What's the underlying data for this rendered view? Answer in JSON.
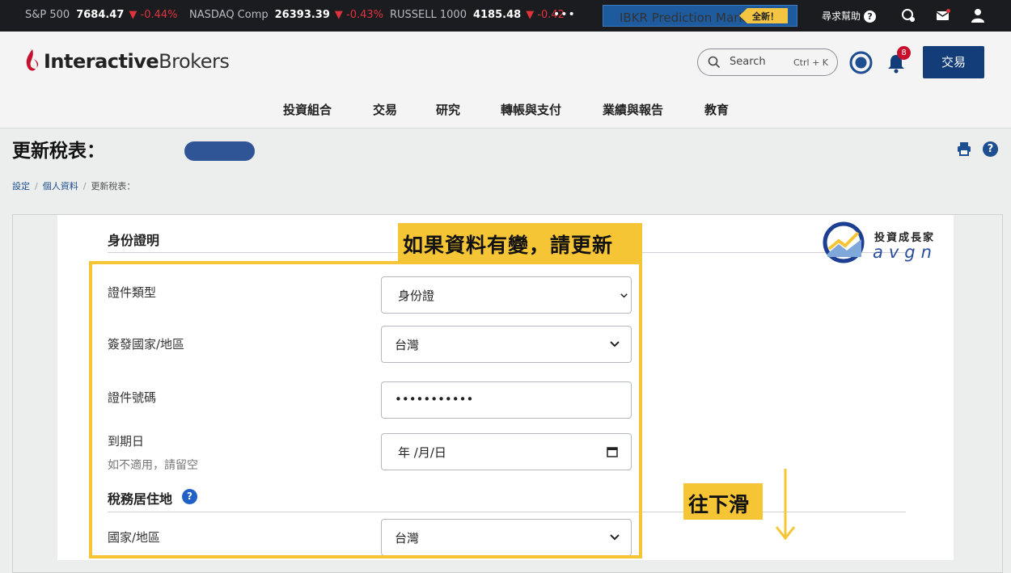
{
  "ticker": {
    "items": [
      {
        "name": "S&P 500",
        "value": "7684.47",
        "change": "▼ -0.44%"
      },
      {
        "name": "NASDAQ Comp",
        "value": "26393.39",
        "change": "▼ -0.43%"
      },
      {
        "name": "RUSSELL 1000",
        "value": "4185.48",
        "change": "▼ -0.42"
      }
    ],
    "more": "•••",
    "promo_label": "IBKR Prediction Markets",
    "promo_badge": "全新！",
    "help_label": "尋求幫助",
    "help_q": "?"
  },
  "header": {
    "logo_bold": "Interactive",
    "logo_rest": "Brokers",
    "search_placeholder": "Search",
    "search_shortcut": "Ctrl + K",
    "notification_count": "8",
    "trade_button": "交易",
    "nav": [
      "投資組合",
      "交易",
      "研究",
      "轉帳與支付",
      "業績與報告",
      "教育"
    ]
  },
  "page": {
    "title": "更新稅表：",
    "help": "?",
    "breadcrumb": [
      "設定",
      "個人資料",
      "更新稅表："
    ]
  },
  "form": {
    "identity_section": "身份證明",
    "id_type_label": "證件類型",
    "id_type_value": "身份證",
    "issue_country_label": "簽發國家/地區",
    "issue_country_value": "台灣",
    "id_number_label": "證件號碼",
    "id_number_value": "•••••••••••",
    "expiry_label": "到期日",
    "expiry_hint": "如不適用，請留空",
    "expiry_value": "年 /月/日",
    "tax_section": "稅務居住地",
    "tax_help": "?",
    "tax_country_label": "國家/地區",
    "tax_country_value": "台灣"
  },
  "annotations": {
    "update_banner": "如果資料有變，請更新",
    "scroll_hint": "往下滑",
    "highlight_color": "#f6c535"
  },
  "watermark": {
    "cn": "投資成長家",
    "en": "avgn"
  },
  "colors": {
    "brand_navy": "#123d78",
    "ticker_bg": "#1b1c20",
    "down_red": "#e0323c",
    "link_blue": "#1d4e8f"
  }
}
